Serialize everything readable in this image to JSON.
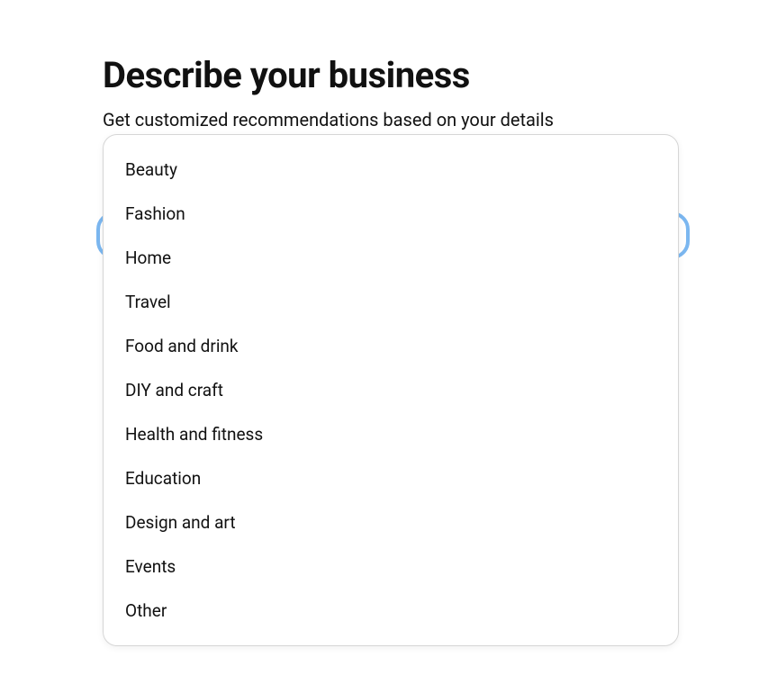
{
  "header": {
    "title": "Describe your business",
    "subtitle": "Get customized recommendations based on your details"
  },
  "dropdown": {
    "options": [
      "Beauty",
      "Fashion",
      "Home",
      "Travel",
      "Food and drink",
      "DIY and craft",
      "Health and fitness",
      "Education",
      "Design and art",
      "Events",
      "Other"
    ]
  }
}
